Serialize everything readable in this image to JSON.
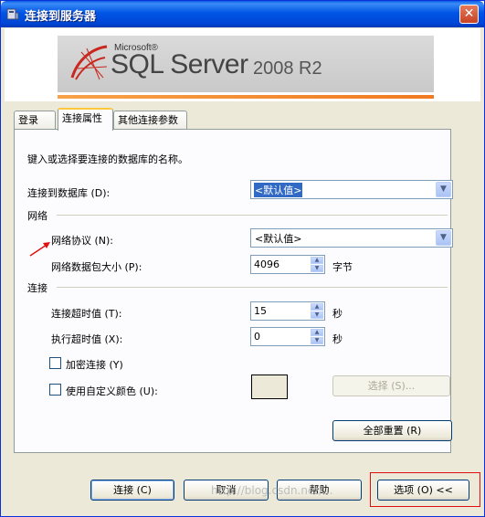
{
  "window": {
    "title": "连接到服务器",
    "close_label": "✕"
  },
  "banner": {
    "brand": "Microsoft®",
    "product": "SQL Server",
    "version": "2008 R2"
  },
  "tabs": [
    {
      "label": "登录"
    },
    {
      "label": "连接属性"
    },
    {
      "label": "其他连接参数"
    }
  ],
  "panel": {
    "instruction": "键入或选择要连接的数据库的名称。",
    "database_label": "连接到数据库 (D):",
    "database_value": "<默认值>",
    "section_network": "网络",
    "protocol_label": "网络协议 (N):",
    "protocol_value": "<默认值>",
    "packet_label": "网络数据包大小 (P):",
    "packet_value": "4096",
    "packet_unit": "字节",
    "section_connection": "连接",
    "conn_timeout_label": "连接超时值 (T):",
    "conn_timeout_value": "15",
    "conn_timeout_unit": "秒",
    "exec_timeout_label": "执行超时值 (X):",
    "exec_timeout_value": "0",
    "exec_timeout_unit": "秒",
    "encrypt_label": "加密连接 (Y)",
    "custom_color_label": "使用自定义颜色 (U):",
    "select_button": "选择 (S)...",
    "reset_button": "全部重置 (R)"
  },
  "footer": {
    "connect": "连接 (C)",
    "cancel": "取消",
    "help": "帮助",
    "options": "选项 (O) <<"
  },
  "watermark": "http://blog.csdn.net/..."
}
